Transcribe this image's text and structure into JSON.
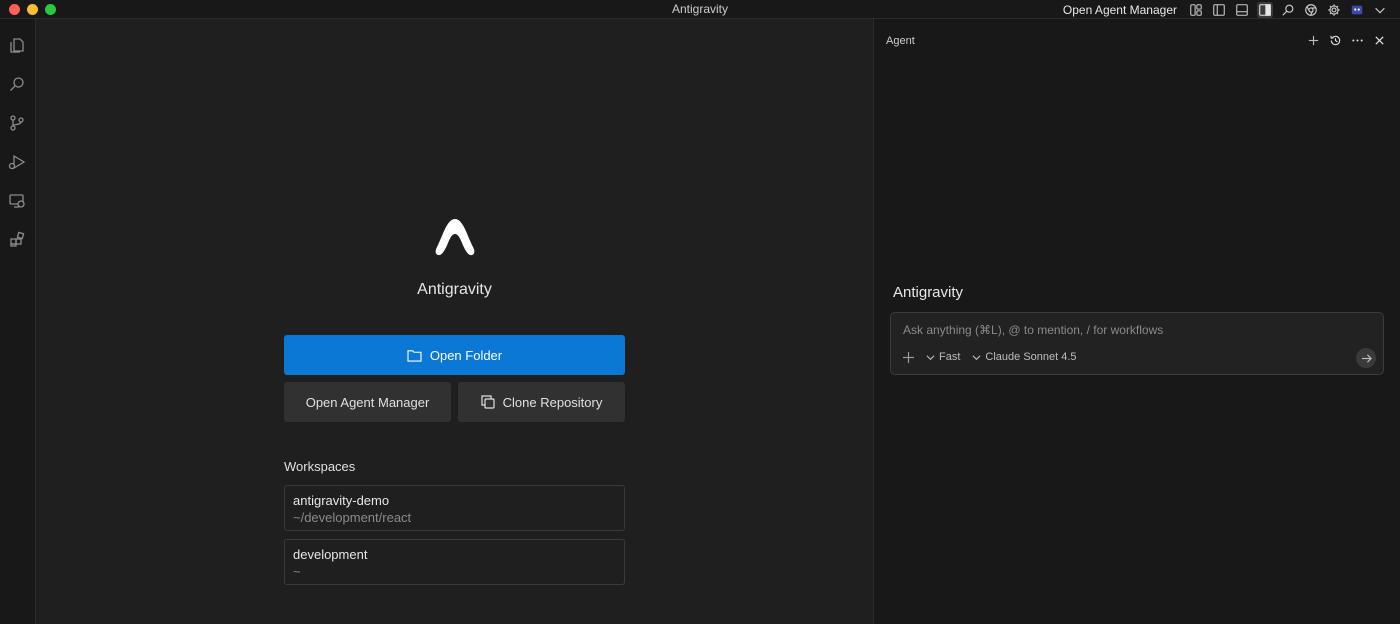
{
  "window": {
    "title": "Antigravity",
    "open_agent_manager_label": "Open Agent Manager"
  },
  "titlebar_icons": [
    "layout-customize-icon",
    "toggle-sidebar-icon",
    "toggle-panel-icon",
    "toggle-secondary-sidebar-icon",
    "search-icon",
    "chrome-icon",
    "settings-icon",
    "account-icon",
    "chevron-down-icon"
  ],
  "activity_bar": [
    "explorer-icon",
    "search-icon",
    "source-control-icon",
    "run-debug-icon",
    "remote-explorer-icon",
    "extensions-icon"
  ],
  "welcome": {
    "brand_name": "Antigravity",
    "open_folder_label": "Open Folder",
    "open_agent_manager_label": "Open Agent Manager",
    "clone_repository_label": "Clone Repository",
    "workspaces_heading": "Workspaces",
    "workspaces": [
      {
        "name": "antigravity-demo",
        "path": "~/development/react"
      },
      {
        "name": "development",
        "path": "~"
      }
    ]
  },
  "agent": {
    "header_label": "Agent",
    "title": "Antigravity",
    "input_placeholder": "Ask anything (⌘L), @ to mention, / for workflows",
    "mode_label": "Fast",
    "model_label": "Claude Sonnet 4.5"
  },
  "colors": {
    "primary_button": "#0a78d4",
    "background": "#1f1f1f",
    "panel": "#181818"
  }
}
